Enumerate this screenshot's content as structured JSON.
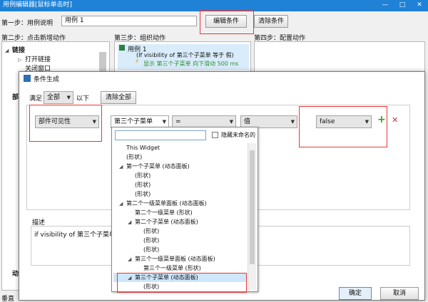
{
  "window": {
    "title": "用例编辑器[鼠标单击时]",
    "minimize": "—",
    "maximize": "□",
    "close": "✕"
  },
  "step1": {
    "label": "第一步：用例说明",
    "value": "用例 1"
  },
  "edit_condition_button": "编辑条件",
  "clear_condition_button": "清除条件",
  "step2": {
    "label": "第二步：点击新增动作",
    "items": [
      "链接",
      "打开链接",
      "关闭窗口"
    ],
    "partial": [
      "部",
      "动"
    ],
    "bottom_label": "垂直"
  },
  "step3": {
    "label": "第三步：组织动作",
    "case_name": "用例 1",
    "condition": "(If visibility of 第三个子菜单 等于 假)",
    "action": "显示 第三个子菜单 向下滑动 500 ms"
  },
  "step4": {
    "label": "第四步：配置动作"
  },
  "dialog": {
    "title": "条件生成",
    "satisfy_label": "满足",
    "satisfy_value": "全部",
    "satisfy_suffix": "以下",
    "clear_all_button": "清除全部",
    "row": {
      "field1": "部件可见性",
      "field2": "第三个子菜单",
      "operator": "=",
      "value_type": "值",
      "value": "false",
      "add_icon": "plus-icon",
      "remove_icon": "close-icon"
    },
    "description_label": "描述",
    "description_text": "if visibility of 第三个子菜单 等",
    "ok_button": "确定",
    "cancel_button": "取消"
  },
  "dropdown": {
    "search_placeholder": "",
    "hide_unnamed_label": "隐藏未命名的",
    "items": [
      {
        "text": "This Widget",
        "indent": 0,
        "expand": false
      },
      {
        "text": "(形状)",
        "indent": 0,
        "expand": false
      },
      {
        "text": "第一个子菜单 (动态面板)",
        "indent": 0,
        "expand": true
      },
      {
        "text": "(形状)",
        "indent": 1,
        "expand": false
      },
      {
        "text": "(形状)",
        "indent": 1,
        "expand": false
      },
      {
        "text": "(形状)",
        "indent": 1,
        "expand": false
      },
      {
        "text": "第二个一级菜单面板 (动态面板)",
        "indent": 0,
        "expand": true
      },
      {
        "text": "第二个一级菜单 (形状)",
        "indent": 1,
        "expand": false
      },
      {
        "text": "第二个子菜单 (动态面板)",
        "indent": 1,
        "expand": true
      },
      {
        "text": "(形状)",
        "indent": 2,
        "expand": false
      },
      {
        "text": "(形状)",
        "indent": 2,
        "expand": false
      },
      {
        "text": "(形状)",
        "indent": 2,
        "expand": false
      },
      {
        "text": "第三个一级菜单面板 (动态面板)",
        "indent": 1,
        "expand": true
      },
      {
        "text": "第三个一级菜单 (形状)",
        "indent": 2,
        "expand": false
      },
      {
        "text": "第三个子菜单 (动态面板)",
        "indent": 1,
        "expand": true,
        "selected": true
      },
      {
        "text": "(形状)",
        "indent": 2,
        "expand": false
      }
    ]
  }
}
